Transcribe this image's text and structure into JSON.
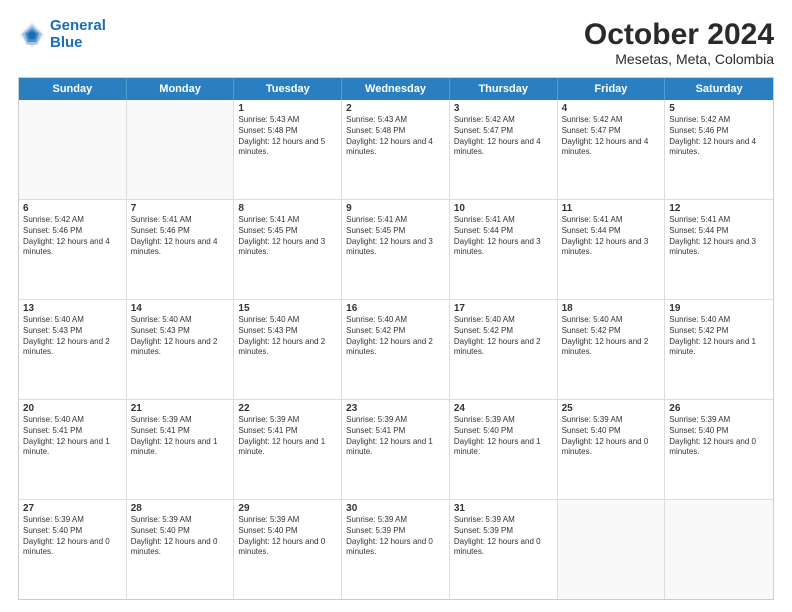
{
  "logo": {
    "line1": "General",
    "line2": "Blue"
  },
  "title": "October 2024",
  "subtitle": "Mesetas, Meta, Colombia",
  "header_days": [
    "Sunday",
    "Monday",
    "Tuesday",
    "Wednesday",
    "Thursday",
    "Friday",
    "Saturday"
  ],
  "weeks": [
    [
      {
        "day": "",
        "text": "",
        "empty": true
      },
      {
        "day": "",
        "text": "",
        "empty": true
      },
      {
        "day": "1",
        "text": "Sunrise: 5:43 AM\nSunset: 5:48 PM\nDaylight: 12 hours and 5 minutes."
      },
      {
        "day": "2",
        "text": "Sunrise: 5:43 AM\nSunset: 5:48 PM\nDaylight: 12 hours and 4 minutes."
      },
      {
        "day": "3",
        "text": "Sunrise: 5:42 AM\nSunset: 5:47 PM\nDaylight: 12 hours and 4 minutes."
      },
      {
        "day": "4",
        "text": "Sunrise: 5:42 AM\nSunset: 5:47 PM\nDaylight: 12 hours and 4 minutes."
      },
      {
        "day": "5",
        "text": "Sunrise: 5:42 AM\nSunset: 5:46 PM\nDaylight: 12 hours and 4 minutes."
      }
    ],
    [
      {
        "day": "6",
        "text": "Sunrise: 5:42 AM\nSunset: 5:46 PM\nDaylight: 12 hours and 4 minutes."
      },
      {
        "day": "7",
        "text": "Sunrise: 5:41 AM\nSunset: 5:46 PM\nDaylight: 12 hours and 4 minutes."
      },
      {
        "day": "8",
        "text": "Sunrise: 5:41 AM\nSunset: 5:45 PM\nDaylight: 12 hours and 3 minutes."
      },
      {
        "day": "9",
        "text": "Sunrise: 5:41 AM\nSunset: 5:45 PM\nDaylight: 12 hours and 3 minutes."
      },
      {
        "day": "10",
        "text": "Sunrise: 5:41 AM\nSunset: 5:44 PM\nDaylight: 12 hours and 3 minutes."
      },
      {
        "day": "11",
        "text": "Sunrise: 5:41 AM\nSunset: 5:44 PM\nDaylight: 12 hours and 3 minutes."
      },
      {
        "day": "12",
        "text": "Sunrise: 5:41 AM\nSunset: 5:44 PM\nDaylight: 12 hours and 3 minutes."
      }
    ],
    [
      {
        "day": "13",
        "text": "Sunrise: 5:40 AM\nSunset: 5:43 PM\nDaylight: 12 hours and 2 minutes."
      },
      {
        "day": "14",
        "text": "Sunrise: 5:40 AM\nSunset: 5:43 PM\nDaylight: 12 hours and 2 minutes."
      },
      {
        "day": "15",
        "text": "Sunrise: 5:40 AM\nSunset: 5:43 PM\nDaylight: 12 hours and 2 minutes."
      },
      {
        "day": "16",
        "text": "Sunrise: 5:40 AM\nSunset: 5:42 PM\nDaylight: 12 hours and 2 minutes."
      },
      {
        "day": "17",
        "text": "Sunrise: 5:40 AM\nSunset: 5:42 PM\nDaylight: 12 hours and 2 minutes."
      },
      {
        "day": "18",
        "text": "Sunrise: 5:40 AM\nSunset: 5:42 PM\nDaylight: 12 hours and 2 minutes."
      },
      {
        "day": "19",
        "text": "Sunrise: 5:40 AM\nSunset: 5:42 PM\nDaylight: 12 hours and 1 minute."
      }
    ],
    [
      {
        "day": "20",
        "text": "Sunrise: 5:40 AM\nSunset: 5:41 PM\nDaylight: 12 hours and 1 minute."
      },
      {
        "day": "21",
        "text": "Sunrise: 5:39 AM\nSunset: 5:41 PM\nDaylight: 12 hours and 1 minute."
      },
      {
        "day": "22",
        "text": "Sunrise: 5:39 AM\nSunset: 5:41 PM\nDaylight: 12 hours and 1 minute."
      },
      {
        "day": "23",
        "text": "Sunrise: 5:39 AM\nSunset: 5:41 PM\nDaylight: 12 hours and 1 minute."
      },
      {
        "day": "24",
        "text": "Sunrise: 5:39 AM\nSunset: 5:40 PM\nDaylight: 12 hours and 1 minute."
      },
      {
        "day": "25",
        "text": "Sunrise: 5:39 AM\nSunset: 5:40 PM\nDaylight: 12 hours and 0 minutes."
      },
      {
        "day": "26",
        "text": "Sunrise: 5:39 AM\nSunset: 5:40 PM\nDaylight: 12 hours and 0 minutes."
      }
    ],
    [
      {
        "day": "27",
        "text": "Sunrise: 5:39 AM\nSunset: 5:40 PM\nDaylight: 12 hours and 0 minutes."
      },
      {
        "day": "28",
        "text": "Sunrise: 5:39 AM\nSunset: 5:40 PM\nDaylight: 12 hours and 0 minutes."
      },
      {
        "day": "29",
        "text": "Sunrise: 5:39 AM\nSunset: 5:40 PM\nDaylight: 12 hours and 0 minutes."
      },
      {
        "day": "30",
        "text": "Sunrise: 5:39 AM\nSunset: 5:39 PM\nDaylight: 12 hours and 0 minutes."
      },
      {
        "day": "31",
        "text": "Sunrise: 5:39 AM\nSunset: 5:39 PM\nDaylight: 12 hours and 0 minutes."
      },
      {
        "day": "",
        "text": "",
        "empty": true
      },
      {
        "day": "",
        "text": "",
        "empty": true
      }
    ]
  ]
}
